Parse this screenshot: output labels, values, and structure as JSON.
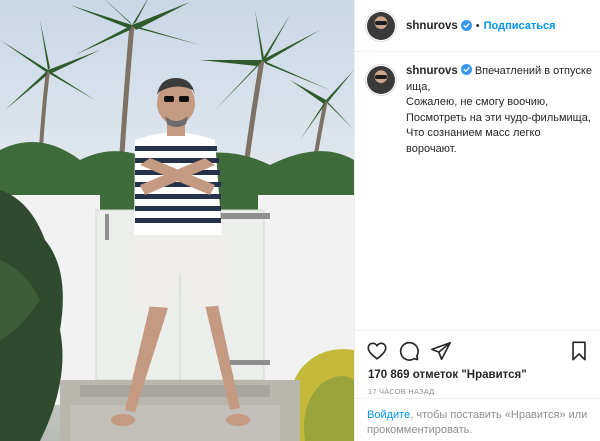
{
  "post": {
    "username": "shnurovs",
    "follow_label": "Подписаться",
    "separator": "•"
  },
  "caption": {
    "username": "shnurovs",
    "lines": [
      "Впечатлений в отпуске",
      "ища,",
      "Сожалею, не смогу воочию,",
      "Посмотреть на эти чудо-фильмища,",
      "Что сознанием масс легко",
      "ворочают."
    ]
  },
  "stats": {
    "likes": "170 869 отметок \"Нравится\"",
    "time": "17 часов назад"
  },
  "login_prompt": {
    "link": "Войдите",
    "text": ", чтобы поставить «Нравится» или прокомментировать."
  },
  "icons": {
    "like": "heart-icon",
    "comment": "comment-icon",
    "share": "share-icon",
    "save": "bookmark-icon",
    "verified": "verified-badge-icon"
  },
  "colors": {
    "accent": "#0095f6",
    "verified": "#3897f0",
    "text": "#262626",
    "muted": "#8e8e8e"
  }
}
